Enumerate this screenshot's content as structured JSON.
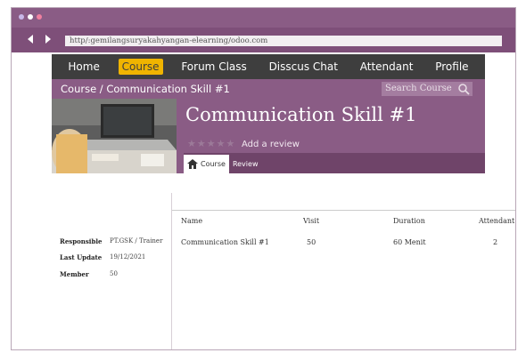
{
  "browser": {
    "url": "http/:gemilangsuryakahyangan-elearning/odoo.com",
    "dot_colors": [
      "#c8b8e8",
      "#ffffff",
      "#f080a0"
    ]
  },
  "nav": {
    "items": [
      "Home",
      "Course",
      "Forum Class",
      "Disscus Chat",
      "Attendant",
      "Profile"
    ],
    "active_index": 1
  },
  "breadcrumb": "Course / Communication Skill #1",
  "search": {
    "placeholder": "Search Course"
  },
  "course": {
    "title": "Communication Skill #1",
    "stars": "★★★★★",
    "review_label": "Add a review",
    "tabs": [
      "Course",
      "Review"
    ]
  },
  "details": [
    {
      "label": "Responsible",
      "value": "PT.GSK / Trainer"
    },
    {
      "label": "Last Update",
      "value": "19/12/2021"
    },
    {
      "label": "Member",
      "value": "50"
    }
  ],
  "table": {
    "headers": [
      "Name",
      "Visit",
      "Duration",
      "Attendant"
    ],
    "rows": [
      [
        "Communication Skill #1",
        "50",
        "60 Menit",
        "2"
      ]
    ]
  },
  "colors": {
    "brand_purple": "#8a5c85",
    "nav_dark": "#3e3e3e",
    "active_yellow": "#f0b400"
  }
}
